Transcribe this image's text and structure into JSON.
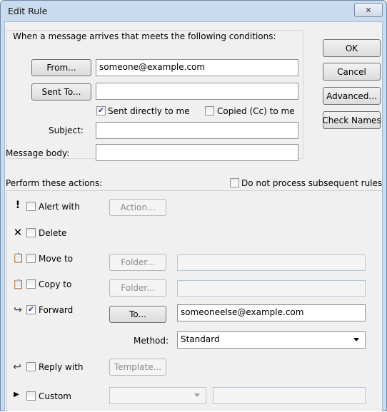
{
  "window": {
    "title": "Edit Rule",
    "close_glyph": "✕"
  },
  "conditions": {
    "heading": "When a message arrives that meets the following conditions:",
    "from_button": "From...",
    "from_value": "someone@example.com",
    "sent_to_button": "Sent To...",
    "sent_to_value": "",
    "sent_directly_label": "Sent directly to me",
    "sent_directly_checked": true,
    "copied_label": "Copied (Cc) to me",
    "copied_checked": false,
    "subject_label": "Subject:",
    "subject_value": "",
    "body_label": "Message body:",
    "body_value": ""
  },
  "side_buttons": {
    "ok": "OK",
    "cancel": "Cancel",
    "advanced": "Advanced...",
    "check_names": "Check Names"
  },
  "actions": {
    "heading": "Perform these actions:",
    "do_not_process_label": "Do not process subsequent rules",
    "do_not_process_checked": false,
    "alert": {
      "icon": "exclamation-icon",
      "glyph": "!",
      "label": "Alert with",
      "checked": false,
      "button": "Action..."
    },
    "delete": {
      "icon": "delete-x-icon",
      "glyph": "✕",
      "label": "Delete",
      "checked": false
    },
    "move": {
      "icon": "move-to-folder-icon",
      "glyph": "📋",
      "label": "Move to",
      "checked": false,
      "button": "Folder...",
      "value": ""
    },
    "copy": {
      "icon": "copy-to-folder-icon",
      "glyph": "📋",
      "label": "Copy to",
      "checked": false,
      "button": "Folder...",
      "value": ""
    },
    "forward": {
      "icon": "forward-icon",
      "glyph": "↪",
      "label": "Forward",
      "checked": true,
      "button": "To...",
      "value": "someoneelse@example.com",
      "method_label": "Method:",
      "method_value": "Standard"
    },
    "reply": {
      "icon": "reply-icon",
      "glyph": "↩",
      "label": "Reply with",
      "checked": false,
      "button": "Template..."
    },
    "custom": {
      "icon": "expand-arrow-icon",
      "glyph": "▶",
      "label": "Custom",
      "checked": false,
      "select_value": "",
      "value": ""
    }
  }
}
